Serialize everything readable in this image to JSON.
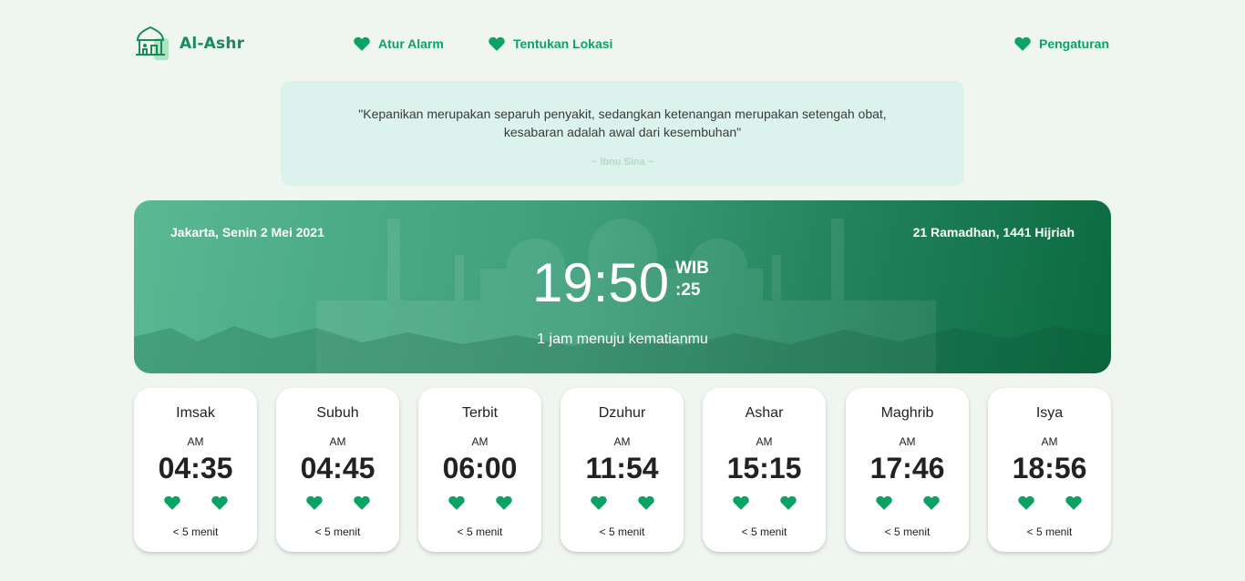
{
  "brand": {
    "name": "Al-Ashr"
  },
  "nav": {
    "alarm": "Atur Alarm",
    "location": "Tentukan Lokasi",
    "settings": "Pengaturan"
  },
  "quote": {
    "text": "\"Kepanikan merupakan separuh penyakit, sedangkan ketenangan merupakan setengah obat, kesabaran adalah awal dari kesembuhan\"",
    "author": "~ Ibnu Sina ~"
  },
  "hero": {
    "location_date": "Jakarta, Senin 2 Mei 2021",
    "hijri": "21 Ramadhan, 1441 Hijriah",
    "time": "19:50",
    "zone": "WIB",
    "seconds": ":25",
    "countdown": "1 jam menuju kematianmu"
  },
  "prayers": [
    {
      "name": "Imsak",
      "ampm": "AM",
      "time": "04:35",
      "note": "< 5 menit"
    },
    {
      "name": "Subuh",
      "ampm": "AM",
      "time": "04:45",
      "note": "< 5 menit"
    },
    {
      "name": "Terbit",
      "ampm": "AM",
      "time": "06:00",
      "note": "< 5 menit"
    },
    {
      "name": "Dzuhur",
      "ampm": "AM",
      "time": "11:54",
      "note": "< 5 menit"
    },
    {
      "name": "Ashar",
      "ampm": "AM",
      "time": "15:15",
      "note": "< 5 menit"
    },
    {
      "name": "Maghrib",
      "ampm": "AM",
      "time": "17:46",
      "note": "< 5 menit"
    },
    {
      "name": "Isya",
      "ampm": "AM",
      "time": "18:56",
      "note": "< 5 menit"
    }
  ],
  "icons": {
    "nav": "heart-icon",
    "card": "heart-icon",
    "logo": "mosque-logo"
  },
  "colors": {
    "accent": "#0aa364",
    "brand": "#1b8a5a",
    "background": "#eff5ef",
    "quote_bg": "#dcf2ec"
  }
}
